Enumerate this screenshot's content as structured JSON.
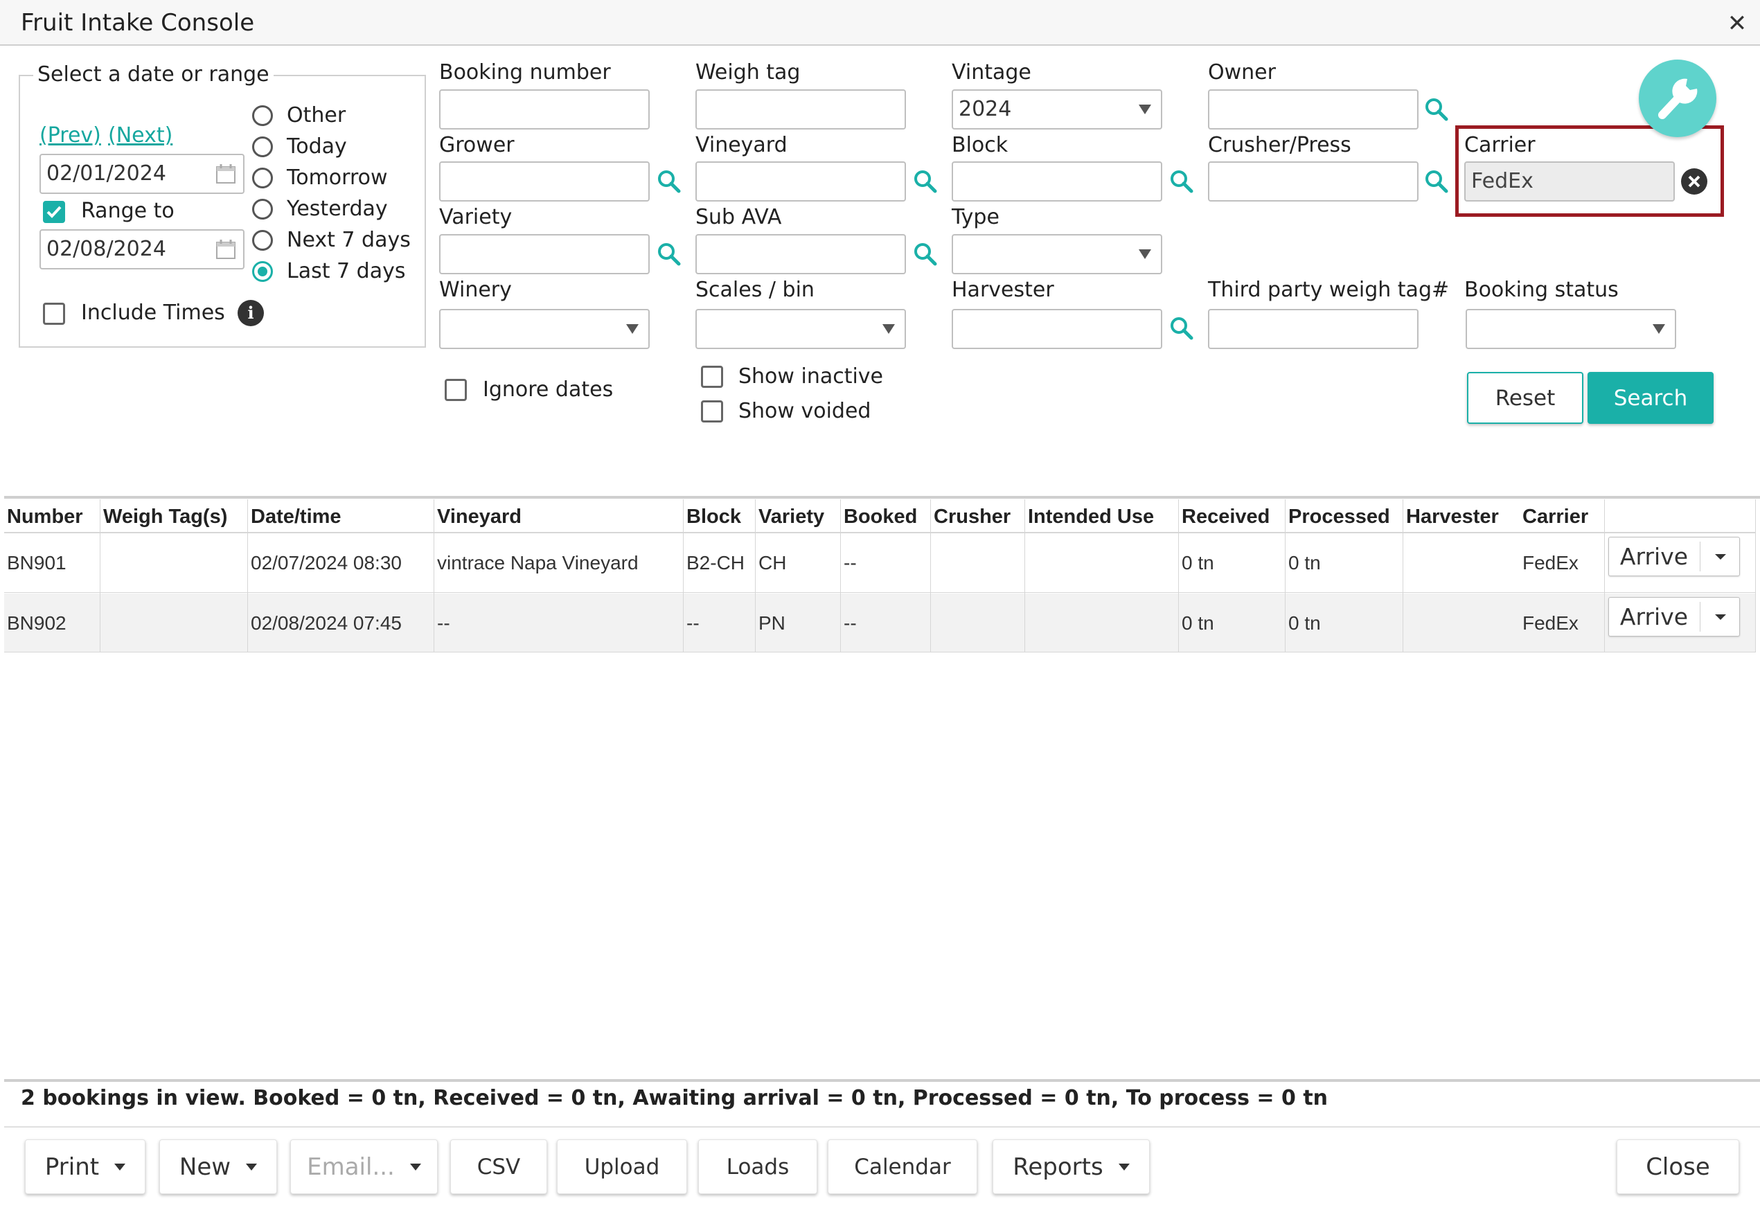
{
  "window": {
    "title": "Fruit Intake Console",
    "close_glyph": "✕"
  },
  "date_panel": {
    "legend": "Select a date or range",
    "prev": "(Prev)",
    "next": "(Next)",
    "from_date": "02/01/2024",
    "range_label": "Range to",
    "range_checked": true,
    "to_date": "02/08/2024",
    "include_times": "Include Times",
    "info_glyph": "i",
    "options": [
      "Other",
      "Today",
      "Tomorrow",
      "Yesterday",
      "Next 7 days",
      "Last 7 days"
    ],
    "selected_option": "Last 7 days"
  },
  "fields": {
    "booking_number": {
      "label": "Booking number",
      "value": ""
    },
    "weigh_tag": {
      "label": "Weigh tag",
      "value": ""
    },
    "vintage": {
      "label": "Vintage",
      "value": "2024"
    },
    "owner": {
      "label": "Owner",
      "value": ""
    },
    "grower": {
      "label": "Grower",
      "value": ""
    },
    "vineyard": {
      "label": "Vineyard",
      "value": ""
    },
    "block": {
      "label": "Block",
      "value": ""
    },
    "crusher_press": {
      "label": "Crusher/Press",
      "value": ""
    },
    "carrier": {
      "label": "Carrier",
      "value": "FedEx"
    },
    "variety": {
      "label": "Variety",
      "value": ""
    },
    "sub_ava": {
      "label": "Sub AVA",
      "value": ""
    },
    "type": {
      "label": "Type",
      "value": ""
    },
    "winery": {
      "label": "Winery",
      "value": ""
    },
    "scales_bin": {
      "label": "Scales / bin",
      "value": ""
    },
    "harvester": {
      "label": "Harvester",
      "value": ""
    },
    "third_party": {
      "label": "Third party weigh tag#",
      "value": ""
    },
    "booking_status": {
      "label": "Booking status",
      "value": ""
    }
  },
  "checks": {
    "ignore_dates": "Ignore dates",
    "show_inactive": "Show inactive",
    "show_voided": "Show voided"
  },
  "actions": {
    "reset": "Reset",
    "search": "Search"
  },
  "colors": {
    "accent": "#1ab0a8",
    "highlight_border": "#9b1b22",
    "wrench_bg": "#5fd3cc"
  },
  "table": {
    "columns": [
      "Number",
      "Weigh Tag(s)",
      "Date/time",
      "Vineyard",
      "Block",
      "Variety",
      "Booked",
      "Crusher",
      "Intended Use",
      "Received",
      "Processed",
      "Harvester",
      "Carrier"
    ],
    "rows": [
      {
        "number": "BN901",
        "weigh_tags": "",
        "datetime": "02/07/2024 08:30",
        "vineyard": "vintrace Napa Vineyard",
        "block": "B2-CH",
        "variety": "CH",
        "booked": "--",
        "crusher": "",
        "intended_use": "",
        "received": "0 tn",
        "processed": "0 tn",
        "harvester": "",
        "carrier": "FedEx",
        "action": "Arrive"
      },
      {
        "number": "BN902",
        "weigh_tags": "",
        "datetime": "02/08/2024 07:45",
        "vineyard": "--",
        "block": "--",
        "variety": "PN",
        "booked": "--",
        "crusher": "",
        "intended_use": "",
        "received": "0 tn",
        "processed": "0 tn",
        "harvester": "",
        "carrier": "FedEx",
        "action": "Arrive"
      }
    ]
  },
  "summary": "2 bookings in view. Booked = 0 tn, Received = 0 tn, Awaiting arrival = 0 tn, Processed = 0 tn, To process = 0 tn",
  "footer": {
    "print": "Print",
    "new": "New",
    "email": "Email...",
    "csv": "CSV",
    "upload": "Upload",
    "loads": "Loads",
    "calendar": "Calendar",
    "reports": "Reports",
    "close": "Close"
  }
}
